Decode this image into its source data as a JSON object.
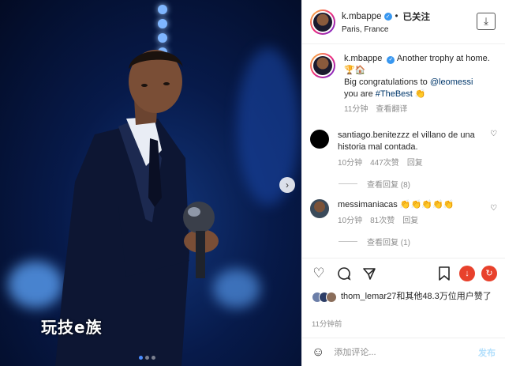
{
  "post": {
    "username": "k.mbappe",
    "follow_label": "已关注",
    "location": "Paris, France",
    "watermark": "玩技e族"
  },
  "caption": {
    "username": "k.mbappe",
    "text_1": "Another trophy at home. 🏆🏠",
    "text_2": "Big congratulations to",
    "mention": "@leomessi",
    "text_3": "you are",
    "hashtag": "#TheBest",
    "emoji": "👏",
    "time": "11分钟",
    "translate": "查看翻译"
  },
  "comments": [
    {
      "username": "santiago.benitezzz",
      "text": "el villano de una historia mal contada.",
      "time": "10分钟",
      "likes": "447次赞",
      "reply": "回复",
      "more": "查看回复 (8)"
    },
    {
      "username": "messimaniacas",
      "text": "👏👏👏👏👏",
      "time": "10分钟",
      "likes": "81次赞",
      "reply": "回复",
      "more": "查看回复 (1)"
    }
  ],
  "likes": {
    "text": "thom_lemar27和其他48.3万位用户赞了"
  },
  "time": "11分钟前",
  "add_comment": {
    "placeholder": "添加评论...",
    "post_label": "发布"
  },
  "colors": {
    "accent": "#3897f0",
    "link": "#00376b",
    "muted": "#8e8e8e",
    "red_button": "#e8412c"
  }
}
